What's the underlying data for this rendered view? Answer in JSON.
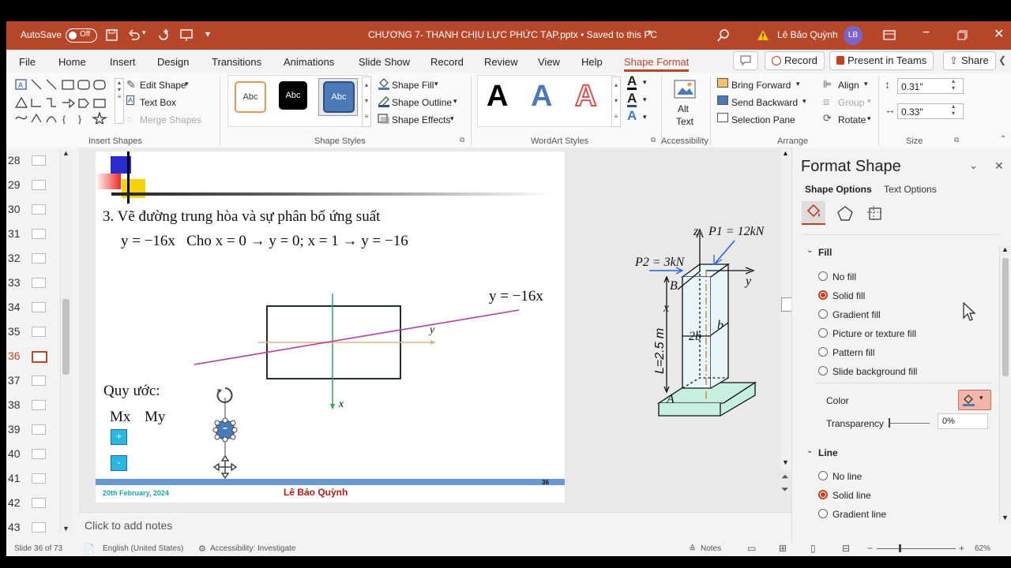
{
  "titlebar": {
    "autosave_label": "AutoSave",
    "autosave_state": "Off",
    "document_title": "CHƯƠNG 7- THANH CHỊU LỰC PHỨC TẠP.pptx  •  Saved to this PC",
    "user_name": "Lê Bảo Quỳnh",
    "user_initials": "LB"
  },
  "menu": {
    "tabs": [
      "File",
      "Home",
      "Insert",
      "Design",
      "Transitions",
      "Animations",
      "Slide Show",
      "Record",
      "Review",
      "View",
      "Help",
      "Shape Format"
    ],
    "record_button": "Record",
    "present_button": "Present in Teams",
    "share_button": "Share"
  },
  "ribbon": {
    "insert_shapes": {
      "edit_shape": "Edit Shape",
      "text_box": "Text Box",
      "merge_shapes": "Merge Shapes",
      "label": "Insert Shapes"
    },
    "shape_styles": {
      "samples": [
        "Abc",
        "Abc",
        "Abc"
      ],
      "shape_fill": "Shape Fill",
      "shape_outline": "Shape Outline",
      "shape_effects": "Shape Effects",
      "label": "Shape Styles"
    },
    "wordart": {
      "samples": [
        "A",
        "A",
        "A"
      ],
      "label": "WordArt Styles"
    },
    "accessibility": {
      "alt_text_1": "Alt",
      "alt_text_2": "Text",
      "label": "Accessibility"
    },
    "arrange": {
      "bring_forward": "Bring Forward",
      "send_backward": "Send Backward",
      "selection_pane": "Selection Pane",
      "align": "Align",
      "group": "Group",
      "rotate": "Rotate",
      "label": "Arrange"
    },
    "size": {
      "height": "0.31\"",
      "width": "0.33\"",
      "label": "Size"
    }
  },
  "thumbnails": {
    "numbers": [
      "28",
      "29",
      "30",
      "31",
      "32",
      "33",
      "34",
      "35",
      "36",
      "37",
      "38",
      "39",
      "40",
      "41",
      "42",
      "43"
    ],
    "current": "36"
  },
  "slide": {
    "heading": "3. Vẽ đường trung hòa và sự phân bố ứng suất",
    "equation_line": "y = −16x   Cho x = 0 → y = 0; x = 1 → y = −16",
    "line_label": "y = −16x",
    "axis_y": "y",
    "axis_x": "x",
    "convention_label": "Quy ước:",
    "mx": "Mx",
    "my": "My",
    "plus_sign": "+",
    "minus_sign": "-",
    "footer_date": "20th February, 2024",
    "footer_author": "Lê Bảo Quỳnh",
    "page_number": "36",
    "figure": {
      "p1": "P1 = 12kN",
      "p2": "P2 = 3kN",
      "z": "z",
      "y": "y",
      "x": "x",
      "b_point": "B",
      "a_point": "A",
      "length": "L=2.5 m",
      "width_2b": "2b",
      "depth_b": "b"
    }
  },
  "notes": {
    "placeholder": "Click to add notes"
  },
  "format_pane": {
    "title": "Format Shape",
    "tabs": [
      "Shape Options",
      "Text Options"
    ],
    "fill_section": "Fill",
    "fill_options": [
      "No fill",
      "Solid fill",
      "Gradient fill",
      "Picture or texture fill",
      "Pattern fill",
      "Slide background fill"
    ],
    "fill_selected": "Solid fill",
    "color_label": "Color",
    "transparency_label": "Transparency",
    "transparency_value": "0%",
    "line_section": "Line",
    "line_options": [
      "No line",
      "Solid line",
      "Gradient line"
    ],
    "line_selected": "Solid line"
  },
  "statusbar": {
    "slide_info": "Slide 36 of 73",
    "language": "English (United States)",
    "accessibility": "Accessibility: Investigate",
    "notes": "Notes",
    "zoom": "62%"
  },
  "colors": {
    "brand": "#b7472a",
    "accent_orange": "#c43e1c",
    "slide_footer_bar": "#6a98d0",
    "neutral_line": "#b040a0",
    "handle_blue": "#4a7ab8",
    "convention_box": "#2bb7e6"
  }
}
